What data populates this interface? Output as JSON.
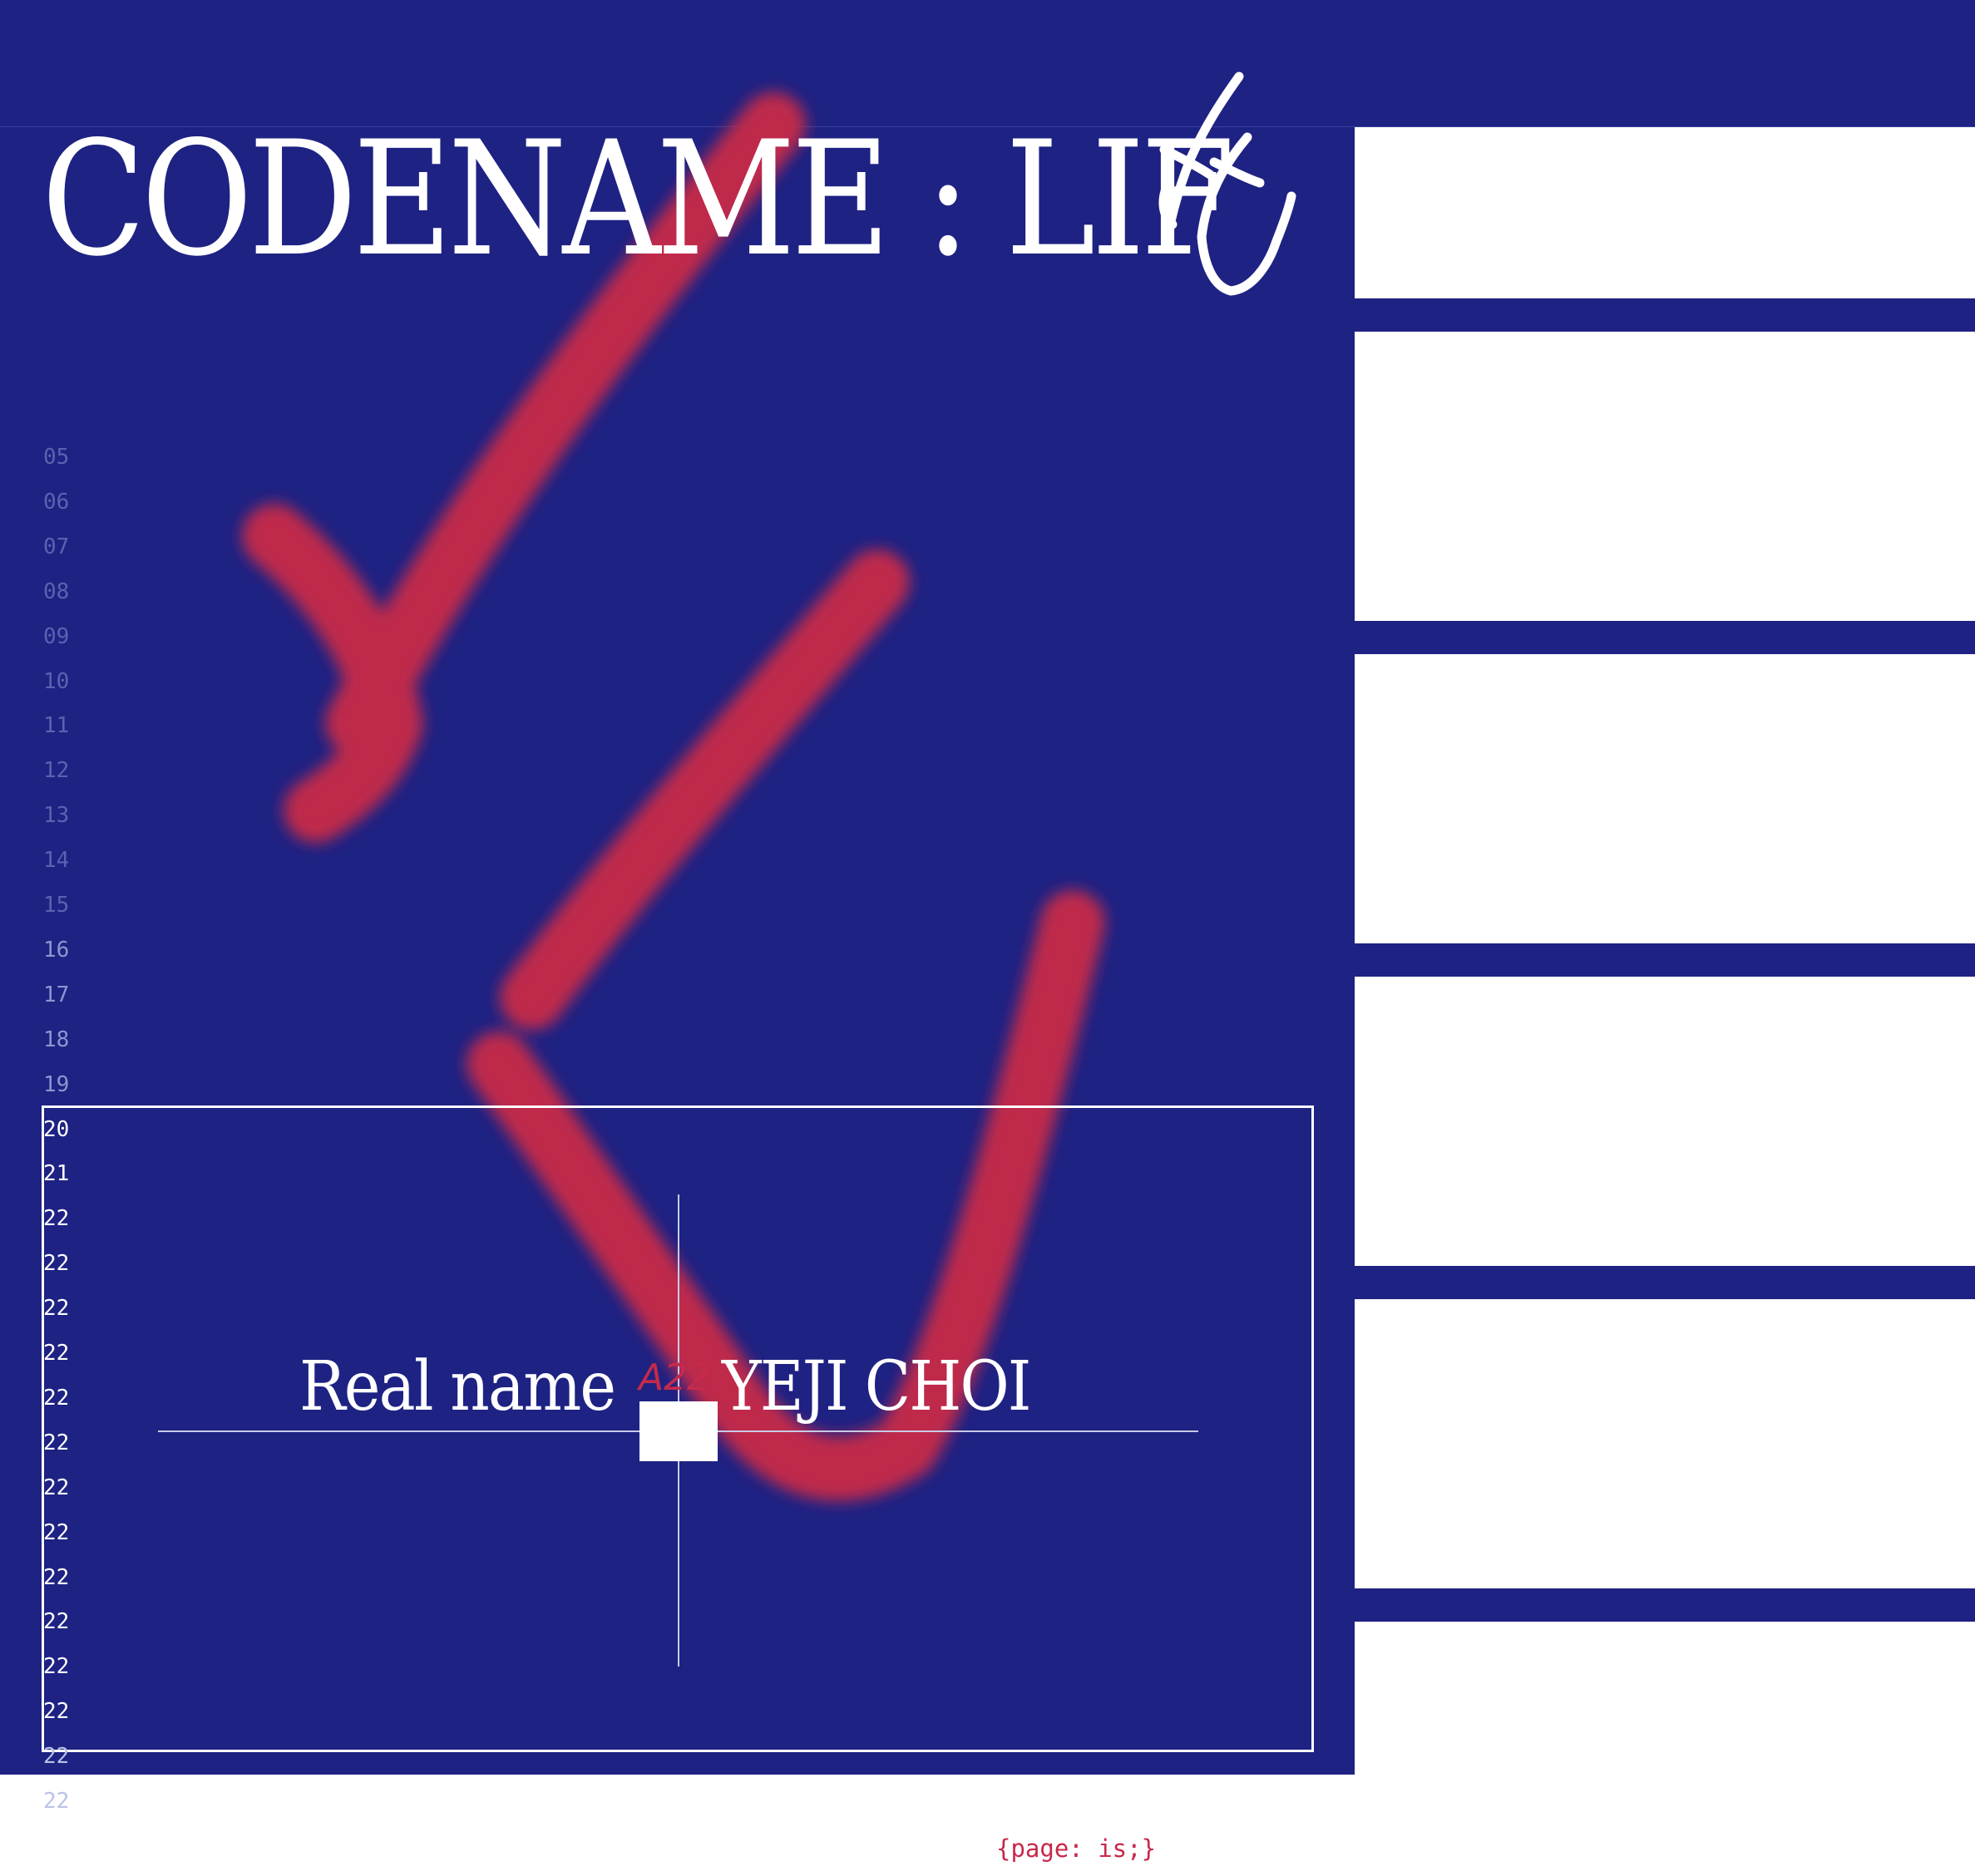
{
  "colors": {
    "navy": "#1e2283",
    "white": "#ffffff",
    "accent_red": "#c8284a",
    "line_number_dim": "#5c62b0",
    "line_number_bright": "#ffffff",
    "line_number_pale": "#b9c2e6"
  },
  "header": {
    "title": "CODENAME : LIF",
    "title_end_glyph": "handwritten-e-glyph"
  },
  "line_numbers": [
    "05",
    "06",
    "07",
    "08",
    "09",
    "10",
    "11",
    "12",
    "13",
    "14",
    "15",
    "16",
    "17",
    "18",
    "19",
    "20",
    "21",
    "22",
    "22",
    "22",
    "22",
    "22",
    "22",
    "22",
    "22",
    "22",
    "22",
    "22",
    "22",
    "22",
    "22"
  ],
  "card": {
    "label": "Real name",
    "value": "YEJI CHOI",
    "cell_ref": "A22"
  },
  "footer": {
    "code": "{page: is;}"
  },
  "graphics": {
    "background_mark": "red-blurred-handwritten-e-icon",
    "signature": "handwritten-e-signature-icon",
    "cursor": "crosshair-cursor-icon"
  }
}
